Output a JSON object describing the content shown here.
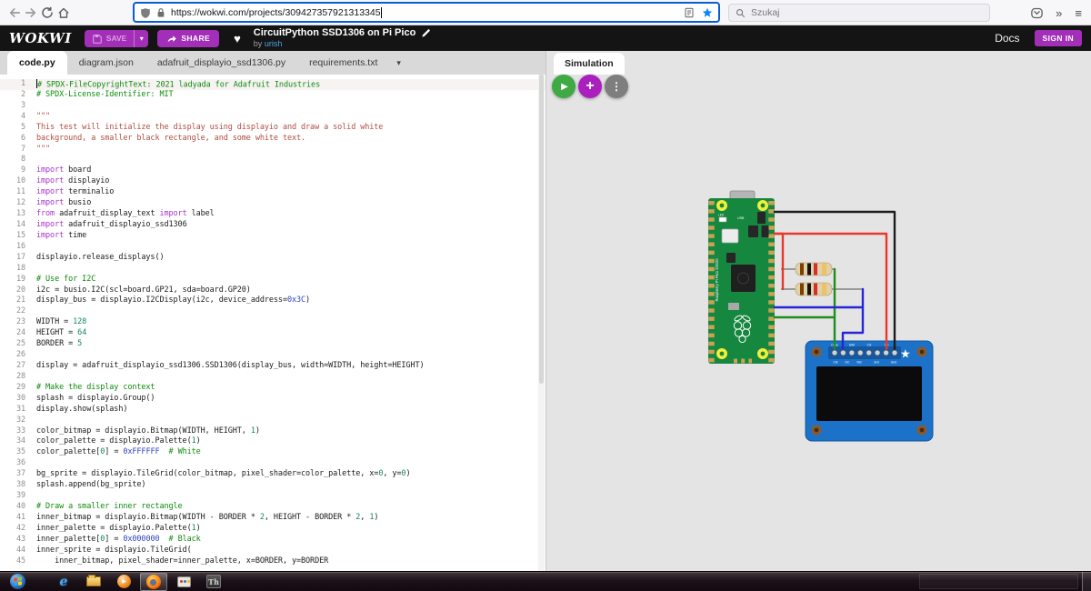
{
  "browser": {
    "url": "https://wokwi.com/projects/309427357921313345",
    "search_placeholder": "Szukaj",
    "overflow_glyph": "»",
    "menu_glyph": "≡"
  },
  "header": {
    "logo": "WOKWI",
    "save_label": "SAVE",
    "save_caret_glyph": "▾",
    "share_label": "SHARE",
    "heart_glyph": "♥",
    "title": "CircuitPython SSD1306 on Pi Pico",
    "byline_prefix": "by",
    "author": "urish",
    "docs_label": "Docs",
    "signin_label": "SIGN IN"
  },
  "file_tabs": {
    "tabs": [
      "code.py",
      "diagram.json",
      "adafruit_displayio_ssd1306.py",
      "requirements.txt"
    ],
    "more_glyph": "▾"
  },
  "simulation": {
    "tab_label": "Simulation",
    "play_glyph": "▶",
    "add_glyph": "+",
    "menu_glyph": "⋮"
  },
  "editor": {
    "language": "python",
    "lines": [
      [
        [
          "c",
          "# SPDX-FileCopyrightText: 2021 ladyada for Adafruit Industries"
        ]
      ],
      [
        [
          "c",
          "# SPDX-License-Identifier: MIT"
        ]
      ],
      [],
      [
        [
          "s",
          "\"\"\""
        ]
      ],
      [
        [
          "s",
          "This test will initialize the display using displayio and draw a solid white"
        ]
      ],
      [
        [
          "s",
          "background, a smaller black rectangle, and some white text."
        ]
      ],
      [
        [
          "s",
          "\"\"\""
        ]
      ],
      [],
      [
        [
          "k",
          "import"
        ],
        [
          "p",
          " board"
        ]
      ],
      [
        [
          "k",
          "import"
        ],
        [
          "p",
          " displayio"
        ]
      ],
      [
        [
          "k",
          "import"
        ],
        [
          "p",
          " terminalio"
        ]
      ],
      [
        [
          "k",
          "import"
        ],
        [
          "p",
          " busio"
        ]
      ],
      [
        [
          "k",
          "from"
        ],
        [
          "p",
          " adafruit_display_text "
        ],
        [
          "k",
          "import"
        ],
        [
          "p",
          " label"
        ]
      ],
      [
        [
          "k",
          "import"
        ],
        [
          "p",
          " adafruit_displayio_ssd1306"
        ]
      ],
      [
        [
          "k",
          "import"
        ],
        [
          "p",
          " time"
        ]
      ],
      [],
      [
        [
          "p",
          "displayio.release_displays()"
        ]
      ],
      [],
      [
        [
          "c",
          "# Use for I2C"
        ]
      ],
      [
        [
          "p",
          "i2c = busio.I2C(scl=board.GP21, sda=board.GP20)"
        ]
      ],
      [
        [
          "p",
          "display_bus = displayio.I2CDisplay(i2c, device_address="
        ],
        [
          "h",
          "0x3C"
        ],
        [
          "p",
          ")"
        ]
      ],
      [],
      [
        [
          "p",
          "WIDTH = "
        ],
        [
          "n",
          "128"
        ]
      ],
      [
        [
          "p",
          "HEIGHT = "
        ],
        [
          "n",
          "64"
        ]
      ],
      [
        [
          "p",
          "BORDER = "
        ],
        [
          "n",
          "5"
        ]
      ],
      [],
      [
        [
          "p",
          "display = adafruit_displayio_ssd1306.SSD1306(display_bus, width=WIDTH, height=HEIGHT)"
        ]
      ],
      [],
      [
        [
          "c",
          "# Make the display context"
        ]
      ],
      [
        [
          "p",
          "splash = displayio.Group()"
        ]
      ],
      [
        [
          "p",
          "display.show(splash)"
        ]
      ],
      [],
      [
        [
          "p",
          "color_bitmap = displayio.Bitmap(WIDTH, HEIGHT, "
        ],
        [
          "n",
          "1"
        ],
        [
          "p",
          ")"
        ]
      ],
      [
        [
          "p",
          "color_palette = displayio.Palette("
        ],
        [
          "n",
          "1"
        ],
        [
          "p",
          ")"
        ]
      ],
      [
        [
          "p",
          "color_palette["
        ],
        [
          "n",
          "0"
        ],
        [
          "p",
          "] = "
        ],
        [
          "h",
          "0xFFFFFF"
        ],
        [
          "p",
          "  "
        ],
        [
          "c",
          "# White"
        ]
      ],
      [],
      [
        [
          "p",
          "bg_sprite = displayio.TileGrid(color_bitmap, pixel_shader=color_palette, x="
        ],
        [
          "n",
          "0"
        ],
        [
          "p",
          ", y="
        ],
        [
          "n",
          "0"
        ],
        [
          "p",
          ")"
        ]
      ],
      [
        [
          "p",
          "splash.append(bg_sprite)"
        ]
      ],
      [],
      [
        [
          "c",
          "# Draw a smaller inner rectangle"
        ]
      ],
      [
        [
          "p",
          "inner_bitmap = displayio.Bitmap(WIDTH - BORDER * "
        ],
        [
          "n",
          "2"
        ],
        [
          "p",
          ", HEIGHT - BORDER * "
        ],
        [
          "n",
          "2"
        ],
        [
          "p",
          ", "
        ],
        [
          "n",
          "1"
        ],
        [
          "p",
          ")"
        ]
      ],
      [
        [
          "p",
          "inner_palette = displayio.Palette("
        ],
        [
          "n",
          "1"
        ],
        [
          "p",
          ")"
        ]
      ],
      [
        [
          "p",
          "inner_palette["
        ],
        [
          "n",
          "0"
        ],
        [
          "p",
          "] = "
        ],
        [
          "h",
          "0x000000"
        ],
        [
          "p",
          "  "
        ],
        [
          "c",
          "# Black"
        ]
      ],
      [
        [
          "p",
          "inner_sprite = displayio.TileGrid("
        ]
      ],
      [
        [
          "p",
          "    inner_bitmap, pixel_shader=inner_palette, x=BORDER, y=BORDER"
        ]
      ]
    ]
  },
  "diagram": {
    "pico": {
      "silkscreen": "Raspberry Pi Pico ©2020",
      "led_label": "LED",
      "usb_label": "USB"
    },
    "oled": {
      "pins_top": [
        "Data",
        "SA0",
        "CS",
        "Vin"
      ],
      "pins_bottom": [
        "Clk",
        "DC",
        "Rst",
        "3v3",
        "Gnd"
      ],
      "star_glyph": "★"
    }
  },
  "taskbar": {
    "items": [
      "start",
      "internet-explorer",
      "windows-explorer",
      "windows-media-player",
      "firefox",
      "paint",
      "th-app"
    ],
    "active_item": "firefox",
    "th_label": "Th"
  },
  "colors": {
    "wokwi_purple": "#A32EB8",
    "play_green": "#3FA944",
    "add_purple": "#AB1FBF",
    "menu_gray": "#7E7E7E",
    "pico_green": "#15873E",
    "oled_blue": "#1B72C8",
    "wire_red": "#E8382E",
    "wire_green": "#1E8C1E",
    "wire_blue": "#2626D8",
    "wire_black": "#1C1C1C",
    "urlbar_focus_blue": "#0A5BD8",
    "bookmark_star_blue": "#0A84FF"
  }
}
